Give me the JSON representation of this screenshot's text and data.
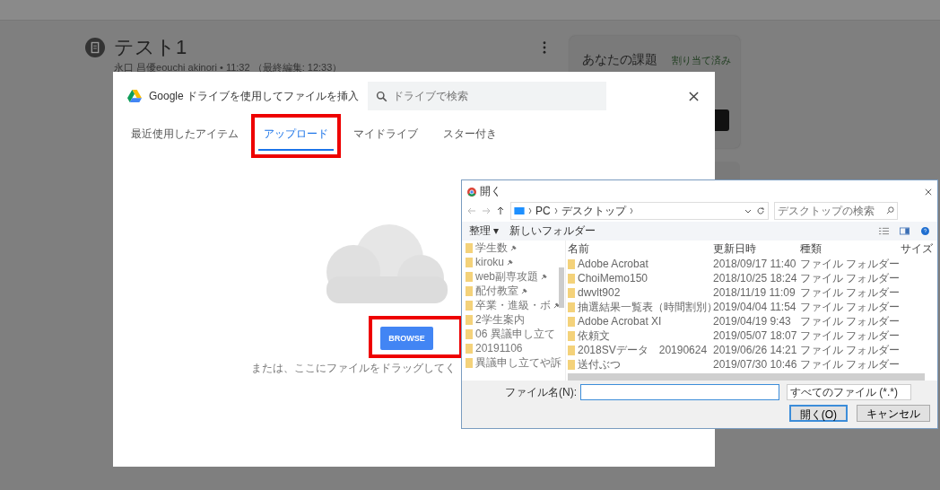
{
  "page": {
    "title": "テスト1",
    "subtitle": "永口 昌優eouchi akinori • 11:32 （最終編集: 12:33）",
    "card": {
      "title": "あなたの課題",
      "status": "割り当て済み"
    }
  },
  "drive_dialog": {
    "title": "Google ドライブを使用してファイルを挿入",
    "search": {
      "placeholder": "ドライブで検索"
    },
    "tabs": [
      {
        "label": "最近使用したアイテム",
        "selected": false
      },
      {
        "label": "アップロード",
        "selected": true
      },
      {
        "label": "マイドライブ",
        "selected": false
      },
      {
        "label": "スター付き",
        "selected": false
      }
    ],
    "browse_button": "BROWSE",
    "drop_hint": "または、ここにファイルをドラッグしてく"
  },
  "open_dialog": {
    "title": "開く",
    "path": [
      "PC",
      "デスクトップ"
    ],
    "search": {
      "placeholder": "デスクトップの検索"
    },
    "toolbar": [
      "整理 ▾",
      "新しいフォルダー"
    ],
    "nav": [
      {
        "label": "学生数",
        "pinned": true
      },
      {
        "label": "kiroku",
        "pinned": true
      },
      {
        "label": "web副専攻題",
        "pinned": true
      },
      {
        "label": "配付教室",
        "pinned": true
      },
      {
        "label": "卒業・進級・ボ",
        "pinned": true
      },
      {
        "label": "2学生案内",
        "pinned": false
      },
      {
        "label": "06 異議申し立て",
        "pinned": false
      },
      {
        "label": "20191106",
        "pinned": false
      },
      {
        "label": "異議申し立てや訴",
        "pinned": false
      }
    ],
    "columns": [
      "名前",
      "更新日時",
      "種類",
      "サイズ"
    ],
    "files": [
      {
        "name": "Adobe Acrobat",
        "date": "2018/09/17 11:40",
        "type": "ファイル フォルダー"
      },
      {
        "name": "ChoiMemo150",
        "date": "2018/10/25 18:24",
        "type": "ファイル フォルダー"
      },
      {
        "name": "dwvlt902",
        "date": "2018/11/19 11:09",
        "type": "ファイル フォルダー"
      },
      {
        "name": "抽選結果一覧表（時間割別）",
        "date": "2019/04/04 11:54",
        "type": "ファイル フォルダー"
      },
      {
        "name": "Adobe Acrobat XI",
        "date": "2019/04/19 9:43",
        "type": "ファイル フォルダー"
      },
      {
        "name": "依頼文",
        "date": "2019/05/07 18:07",
        "type": "ファイル フォルダー"
      },
      {
        "name": "2018SVデータ　20190624",
        "date": "2019/06/26 14:21",
        "type": "ファイル フォルダー"
      },
      {
        "name": "送付ぶつ",
        "date": "2019/07/30 10:46",
        "type": "ファイル フォルダー"
      }
    ],
    "filename_label": "ファイル名(N):",
    "filetype": "すべてのファイル (*.*)",
    "buttons": [
      "開く(O)",
      "キャンセル"
    ]
  }
}
